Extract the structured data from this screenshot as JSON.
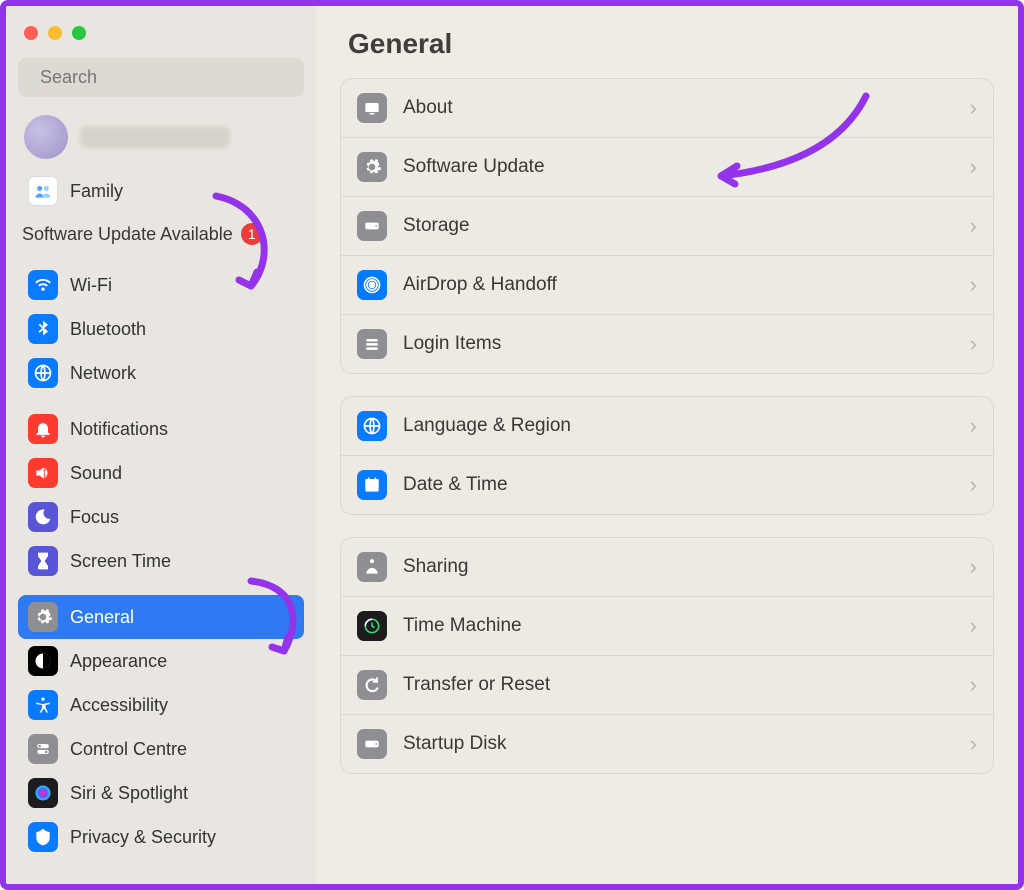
{
  "window": {
    "search_placeholder": "Search"
  },
  "sidebar": {
    "family_label": "Family",
    "update_heading": "Software Update Available",
    "update_badge": "1",
    "groups": [
      {
        "items": [
          {
            "key": "wifi",
            "label": "Wi-Fi"
          },
          {
            "key": "bluetooth",
            "label": "Bluetooth"
          },
          {
            "key": "network",
            "label": "Network"
          }
        ]
      },
      {
        "items": [
          {
            "key": "notifications",
            "label": "Notifications"
          },
          {
            "key": "sound",
            "label": "Sound"
          },
          {
            "key": "focus",
            "label": "Focus"
          },
          {
            "key": "screentime",
            "label": "Screen Time"
          }
        ]
      },
      {
        "items": [
          {
            "key": "general",
            "label": "General",
            "selected": true
          },
          {
            "key": "appearance",
            "label": "Appearance"
          },
          {
            "key": "accessibility",
            "label": "Accessibility"
          },
          {
            "key": "controlcentre",
            "label": "Control Centre"
          },
          {
            "key": "siri",
            "label": "Siri & Spotlight"
          },
          {
            "key": "privacy",
            "label": "Privacy & Security"
          }
        ]
      }
    ]
  },
  "main": {
    "title": "General",
    "groups": [
      {
        "rows": [
          {
            "key": "about",
            "label": "About"
          },
          {
            "key": "softwareupdate",
            "label": "Software Update"
          },
          {
            "key": "storage",
            "label": "Storage"
          },
          {
            "key": "airdrop",
            "label": "AirDrop & Handoff"
          },
          {
            "key": "loginitems",
            "label": "Login Items"
          }
        ]
      },
      {
        "rows": [
          {
            "key": "language",
            "label": "Language & Region"
          },
          {
            "key": "datetime",
            "label": "Date & Time"
          }
        ]
      },
      {
        "rows": [
          {
            "key": "sharing",
            "label": "Sharing"
          },
          {
            "key": "timemachine",
            "label": "Time Machine"
          },
          {
            "key": "transfer",
            "label": "Transfer or Reset"
          },
          {
            "key": "startupdisk",
            "label": "Startup Disk"
          }
        ]
      }
    ]
  },
  "icons": {
    "family": {
      "bg": "#ffffff"
    },
    "wifi": {
      "bg": "#0a7aff"
    },
    "bluetooth": {
      "bg": "#0a7aff"
    },
    "network": {
      "bg": "#0a7aff"
    },
    "notifications": {
      "bg": "#ff3b30"
    },
    "sound": {
      "bg": "#ff3b30"
    },
    "focus": {
      "bg": "#5856d6"
    },
    "screentime": {
      "bg": "#5856d6"
    },
    "general": {
      "bg": "#8e8e93"
    },
    "appearance": {
      "bg": "#000000"
    },
    "accessibility": {
      "bg": "#0a7aff"
    },
    "controlcentre": {
      "bg": "#8e8e93"
    },
    "siri": {
      "bg": "#1c1c1e"
    },
    "privacy": {
      "bg": "#0a7aff"
    },
    "about": {
      "bg": "#8e8e93"
    },
    "softwareupdate": {
      "bg": "#8e8e93"
    },
    "storage": {
      "bg": "#8e8e93"
    },
    "airdrop": {
      "bg": "#007aff"
    },
    "loginitems": {
      "bg": "#8e8e93"
    },
    "language": {
      "bg": "#0a7aff"
    },
    "datetime": {
      "bg": "#0a7aff"
    },
    "sharing": {
      "bg": "#8e8e93"
    },
    "timemachine": {
      "bg": "#1c1c1e"
    },
    "transfer": {
      "bg": "#8e8e93"
    },
    "startupdisk": {
      "bg": "#8e8e93"
    }
  }
}
